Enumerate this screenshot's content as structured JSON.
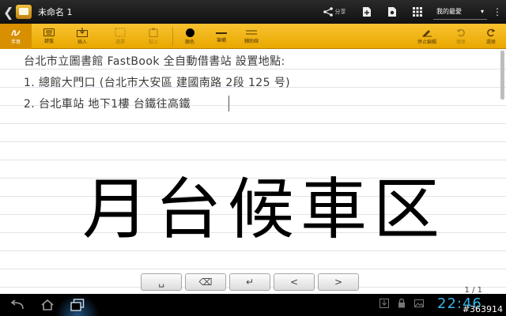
{
  "topbar": {
    "title": "未命名 1",
    "share_label": "分享",
    "favorites_label": "我的最愛",
    "icons": [
      "chevron-left-icon",
      "share-icon",
      "add-page-icon",
      "settings-icon",
      "grid-icon",
      "menu-icon"
    ]
  },
  "toolbar": {
    "items": [
      {
        "label": "手寫",
        "icon": "handwriting-icon",
        "state": "active"
      },
      {
        "label": "鍵盤",
        "icon": "keyboard-icon",
        "state": "normal"
      },
      {
        "label": "插入",
        "icon": "insert-icon",
        "state": "normal"
      },
      {
        "label": "選擇",
        "icon": "select-icon",
        "state": "disabled"
      },
      {
        "label": "黏上",
        "icon": "paste-icon",
        "state": "disabled"
      },
      {
        "label": "顏色",
        "icon": "color-dot-icon",
        "state": "normal"
      },
      {
        "label": "筆觸",
        "icon": "stroke-icon",
        "state": "normal"
      },
      {
        "label": "輔助線",
        "icon": "guideline-icon",
        "state": "normal"
      },
      {
        "label": "停止編輯",
        "icon": "stop-edit-icon",
        "state": "normal"
      },
      {
        "label": "復原",
        "icon": "undo-icon",
        "state": "disabled"
      },
      {
        "label": "還原",
        "icon": "redo-icon",
        "state": "normal"
      }
    ],
    "accent": "#f5b914",
    "ink_color": "#000000"
  },
  "note": {
    "lines": [
      "台北市立圖書館 FastBook 全自動借書站 設置地點:",
      "1. 總館大門口 (台北市大安區 建國南路 2段 125 号)",
      "2. 台北車站 地下1樓 台鐵往高鐵"
    ],
    "handwriting": "月台候車区"
  },
  "keys": [
    {
      "label": "␣",
      "name": "space-key"
    },
    {
      "label": "⌫",
      "name": "backspace-key"
    },
    {
      "label": "↵",
      "name": "enter-key"
    },
    {
      "label": "<",
      "name": "prev-key"
    },
    {
      "label": ">",
      "name": "next-key"
    }
  ],
  "page_indicator": "1 / 1",
  "system": {
    "clock": "22:46",
    "clock_color": "#33b5e5",
    "watermark": "#363914"
  }
}
